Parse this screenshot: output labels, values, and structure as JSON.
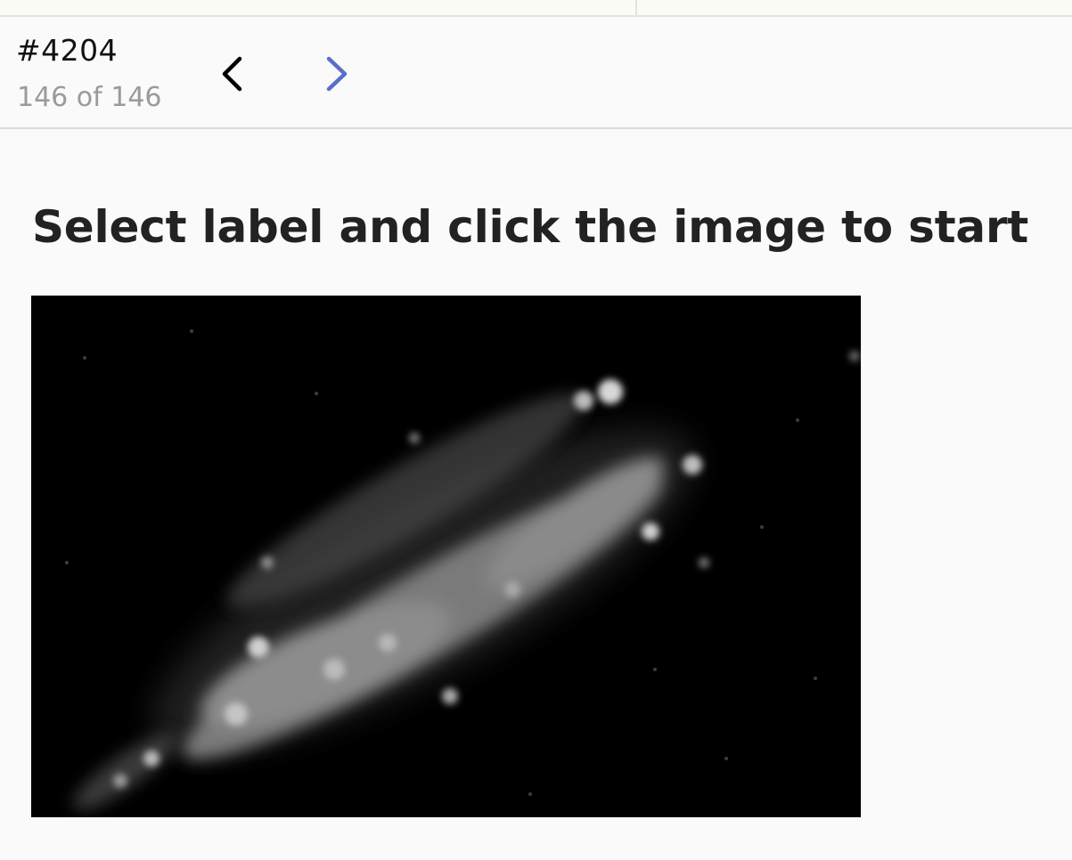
{
  "header": {
    "task_id": "#4204",
    "position_text": "146 of 146",
    "prev_icon": "chevron-left-icon",
    "next_icon": "chevron-right-icon",
    "prev_color": "#000000",
    "next_color": "#5b6fc9"
  },
  "main": {
    "instruction": "Select label and click the image to start"
  }
}
